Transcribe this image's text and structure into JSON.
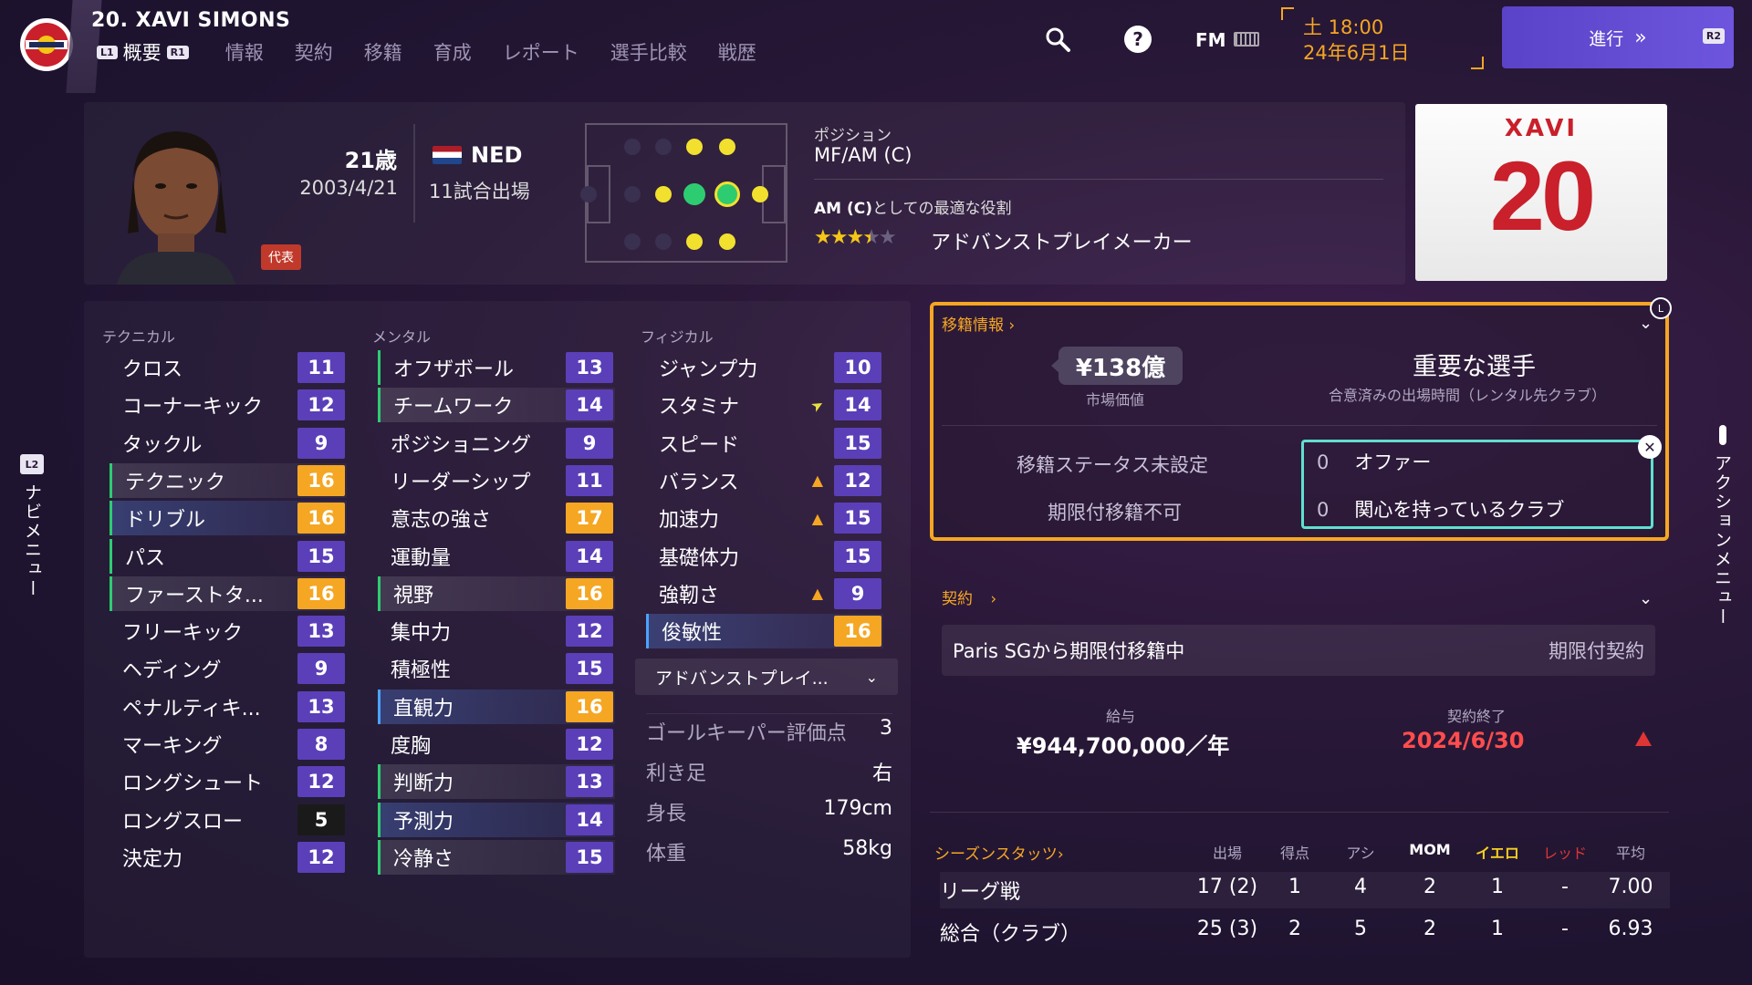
{
  "header": {
    "player_title": "20. XAVI SIMONS",
    "hint_left": "L1",
    "hint_right": "R1",
    "tabs": [
      "概要",
      "情報",
      "契約",
      "移籍",
      "育成",
      "レポート",
      "選手比較",
      "戦歴"
    ],
    "active_tab": "概要",
    "fm_label": "FM",
    "date_line1": "土 18:00",
    "date_line2": "24年6月1日",
    "continue_label": "進行",
    "continue_hint": "R2"
  },
  "profile": {
    "age": "21歳",
    "dob": "2003/4/21",
    "nationality": "NED",
    "caps": "11試合出場",
    "national_badge": "代表",
    "position_heading": "ポジション",
    "position_value": "MF/AM (C)",
    "role_heading_bold": "AM (C)",
    "role_heading_rest": "としての最適な役割",
    "role_stars": 3.5,
    "role_stars_max": 5,
    "role_name": "アドバンストプレイメーカー",
    "shirt_name": "XAVI",
    "shirt_number": "20"
  },
  "attributes": {
    "technical_heading": "テクニカル",
    "mental_heading": "メンタル",
    "physical_heading": "フィジカル",
    "technical": [
      {
        "name": "クロス",
        "value": "11",
        "color": "purple"
      },
      {
        "name": "コーナーキック",
        "value": "12",
        "color": "purple"
      },
      {
        "name": "タックル",
        "value": "9",
        "color": "purple"
      },
      {
        "name": "テクニック",
        "value": "16",
        "color": "orange"
      },
      {
        "name": "ドリブル",
        "value": "16",
        "color": "orange"
      },
      {
        "name": "パス",
        "value": "15",
        "color": "purple"
      },
      {
        "name": "ファーストタ...",
        "value": "16",
        "color": "orange"
      },
      {
        "name": "フリーキック",
        "value": "13",
        "color": "purple"
      },
      {
        "name": "ヘディング",
        "value": "9",
        "color": "purple"
      },
      {
        "name": "ペナルティキ...",
        "value": "13",
        "color": "purple"
      },
      {
        "name": "マーキング",
        "value": "8",
        "color": "purple"
      },
      {
        "name": "ロングシュート",
        "value": "12",
        "color": "purple"
      },
      {
        "name": "ロングスロー",
        "value": "5",
        "color": "dark"
      },
      {
        "name": "決定力",
        "value": "12",
        "color": "purple"
      }
    ],
    "mental": [
      {
        "name": "オフザボール",
        "value": "13",
        "color": "purple"
      },
      {
        "name": "チームワーク",
        "value": "14",
        "color": "purple"
      },
      {
        "name": "ポジショニング",
        "value": "9",
        "color": "purple"
      },
      {
        "name": "リーダーシップ",
        "value": "11",
        "color": "purple"
      },
      {
        "name": "意志の強さ",
        "value": "17",
        "color": "orange"
      },
      {
        "name": "運動量",
        "value": "14",
        "color": "purple"
      },
      {
        "name": "視野",
        "value": "16",
        "color": "orange"
      },
      {
        "name": "集中力",
        "value": "12",
        "color": "purple"
      },
      {
        "name": "積極性",
        "value": "15",
        "color": "purple"
      },
      {
        "name": "直観力",
        "value": "16",
        "color": "orange"
      },
      {
        "name": "度胸",
        "value": "12",
        "color": "purple"
      },
      {
        "name": "判断力",
        "value": "13",
        "color": "purple"
      },
      {
        "name": "予測力",
        "value": "14",
        "color": "purple"
      },
      {
        "name": "冷静さ",
        "value": "15",
        "color": "purple"
      }
    ],
    "physical": [
      {
        "name": "ジャンプ力",
        "value": "10",
        "color": "purple"
      },
      {
        "name": "スタミナ",
        "value": "14",
        "color": "purple"
      },
      {
        "name": "スピード",
        "value": "15",
        "color": "purple"
      },
      {
        "name": "バランス",
        "value": "12",
        "color": "purple"
      },
      {
        "name": "加速力",
        "value": "15",
        "color": "purple"
      },
      {
        "name": "基礎体力",
        "value": "15",
        "color": "purple"
      },
      {
        "name": "強靭さ",
        "value": "9",
        "color": "purple"
      },
      {
        "name": "俊敏性",
        "value": "16",
        "color": "orange"
      }
    ],
    "role_select": "アドバンストプレイ...",
    "misc": [
      {
        "label": "ゴールキーパー評価点",
        "value": "3"
      },
      {
        "label": "利き足",
        "value": "右"
      },
      {
        "label": "身長",
        "value": "179cm"
      },
      {
        "label": "体重",
        "value": "58kg"
      }
    ]
  },
  "transfer": {
    "title": "移籍情報",
    "value": "¥138億",
    "value_label": "市場価値",
    "squad_status": "重要な選手",
    "squad_status_sub": "合意済みの出場時間（レンタル先クラブ）",
    "status_line1": "移籍ステータス未設定",
    "status_line2": "期限付移籍不可",
    "offers_count": "0",
    "offers_label": "オファー",
    "interest_count": "0",
    "interest_label": "関心を持っているクラブ"
  },
  "contract": {
    "title": "契約",
    "loan_text": "Paris SGから期限付移籍中",
    "loan_type": "期限付契約",
    "wage_label": "給与",
    "wage_value": "¥944,700,000／年",
    "expiry_label": "契約終了",
    "expiry_value": "2024/6/30"
  },
  "season_stats": {
    "title": "シーズンスタッツ",
    "columns": [
      "出場",
      "得点",
      "アシ",
      "MOM",
      "イエロ",
      "レッド",
      "平均"
    ],
    "rows": [
      {
        "label": "リーグ戦",
        "values": [
          "17 (2)",
          "1",
          "4",
          "2",
          "1",
          "-",
          "7.00"
        ]
      },
      {
        "label": "総合（クラブ）",
        "values": [
          "25 (3)",
          "2",
          "5",
          "2",
          "1",
          "-",
          "6.93"
        ]
      }
    ]
  },
  "side": {
    "left_hint": "L2",
    "left_label": "ナビメニュー",
    "right_label": "アクションメニュー"
  }
}
